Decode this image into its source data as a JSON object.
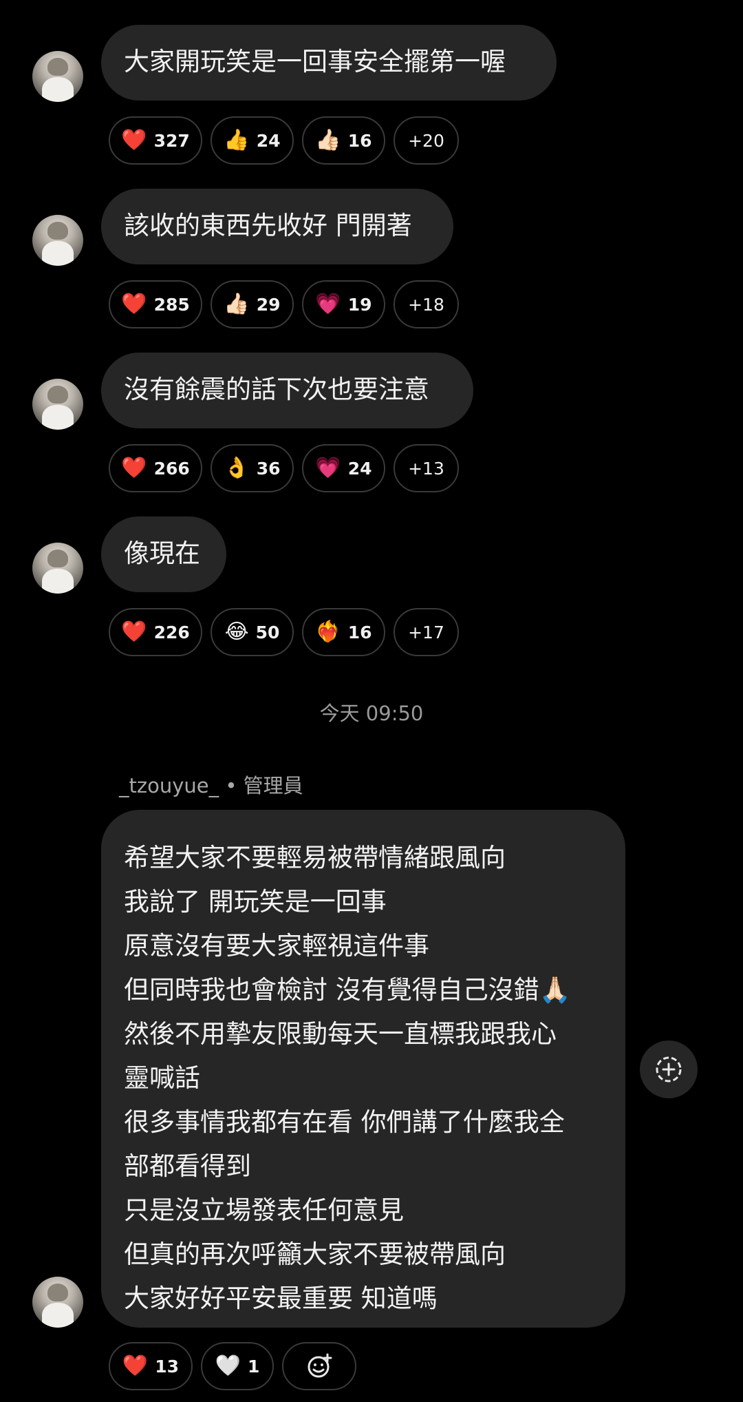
{
  "messages": [
    {
      "text": "大家開玩笑是一回事安全擺第一喔",
      "reactions": [
        {
          "emoji": "❤️",
          "count": "327"
        },
        {
          "emoji": "👍",
          "count": "24"
        },
        {
          "emoji": "👍🏻",
          "count": "16"
        }
      ],
      "more": "+20"
    },
    {
      "text": "該收的東西先收好 門開著",
      "reactions": [
        {
          "emoji": "❤️",
          "count": "285"
        },
        {
          "emoji": "👍🏻",
          "count": "29"
        },
        {
          "emoji": "💗",
          "count": "19"
        }
      ],
      "more": "+18"
    },
    {
      "text": "沒有餘震的話下次也要注意",
      "reactions": [
        {
          "emoji": "❤️",
          "count": "266"
        },
        {
          "emoji": "👌",
          "count": "36"
        },
        {
          "emoji": "💗",
          "count": "24"
        }
      ],
      "more": "+13"
    },
    {
      "text": "像現在",
      "reactions": [
        {
          "emoji": "❤️",
          "count": "226"
        },
        {
          "emoji": "😂",
          "count": "50"
        },
        {
          "emoji": "❤️‍🔥",
          "count": "16"
        }
      ],
      "more": "+17"
    }
  ],
  "timestamp": "今天 09:50",
  "sender": {
    "name": "_tzouyue_",
    "separator": "•",
    "role": "管理員"
  },
  "long_message": {
    "lines": [
      "希望大家不要輕易被帶情緒跟風向",
      "我說了 開玩笑是一回事",
      "原意沒有要大家輕視這件事",
      "但同時我也會檢討 沒有覺得自己沒錯🙏🏻",
      "然後不用摯友限動每天一直標我跟我心",
      "靈喊話",
      "很多事情我都有在看 你們講了什麼我全",
      "部都看得到",
      "只是沒立場發表任何意見",
      "但真的再次呼籲大家不要被帶風向",
      "大家好好平安最重要 知道嗎"
    ],
    "reactions": [
      {
        "emoji": "❤️",
        "count": "13"
      },
      {
        "emoji": "🤍",
        "count": "1"
      }
    ]
  },
  "icons": {
    "add_reaction": "add-reaction-icon",
    "share": "add-circle-icon"
  }
}
